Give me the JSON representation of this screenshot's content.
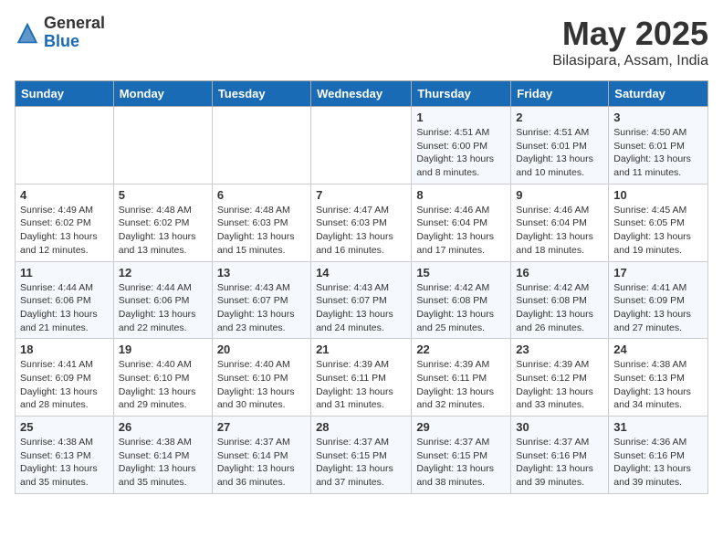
{
  "header": {
    "logo_general": "General",
    "logo_blue": "Blue",
    "month_title": "May 2025",
    "subtitle": "Bilasipara, Assam, India"
  },
  "weekdays": [
    "Sunday",
    "Monday",
    "Tuesday",
    "Wednesday",
    "Thursday",
    "Friday",
    "Saturday"
  ],
  "weeks": [
    [
      {
        "day": "",
        "info": ""
      },
      {
        "day": "",
        "info": ""
      },
      {
        "day": "",
        "info": ""
      },
      {
        "day": "",
        "info": ""
      },
      {
        "day": "1",
        "info": "Sunrise: 4:51 AM\nSunset: 6:00 PM\nDaylight: 13 hours and 8 minutes."
      },
      {
        "day": "2",
        "info": "Sunrise: 4:51 AM\nSunset: 6:01 PM\nDaylight: 13 hours and 10 minutes."
      },
      {
        "day": "3",
        "info": "Sunrise: 4:50 AM\nSunset: 6:01 PM\nDaylight: 13 hours and 11 minutes."
      }
    ],
    [
      {
        "day": "4",
        "info": "Sunrise: 4:49 AM\nSunset: 6:02 PM\nDaylight: 13 hours and 12 minutes."
      },
      {
        "day": "5",
        "info": "Sunrise: 4:48 AM\nSunset: 6:02 PM\nDaylight: 13 hours and 13 minutes."
      },
      {
        "day": "6",
        "info": "Sunrise: 4:48 AM\nSunset: 6:03 PM\nDaylight: 13 hours and 15 minutes."
      },
      {
        "day": "7",
        "info": "Sunrise: 4:47 AM\nSunset: 6:03 PM\nDaylight: 13 hours and 16 minutes."
      },
      {
        "day": "8",
        "info": "Sunrise: 4:46 AM\nSunset: 6:04 PM\nDaylight: 13 hours and 17 minutes."
      },
      {
        "day": "9",
        "info": "Sunrise: 4:46 AM\nSunset: 6:04 PM\nDaylight: 13 hours and 18 minutes."
      },
      {
        "day": "10",
        "info": "Sunrise: 4:45 AM\nSunset: 6:05 PM\nDaylight: 13 hours and 19 minutes."
      }
    ],
    [
      {
        "day": "11",
        "info": "Sunrise: 4:44 AM\nSunset: 6:06 PM\nDaylight: 13 hours and 21 minutes."
      },
      {
        "day": "12",
        "info": "Sunrise: 4:44 AM\nSunset: 6:06 PM\nDaylight: 13 hours and 22 minutes."
      },
      {
        "day": "13",
        "info": "Sunrise: 4:43 AM\nSunset: 6:07 PM\nDaylight: 13 hours and 23 minutes."
      },
      {
        "day": "14",
        "info": "Sunrise: 4:43 AM\nSunset: 6:07 PM\nDaylight: 13 hours and 24 minutes."
      },
      {
        "day": "15",
        "info": "Sunrise: 4:42 AM\nSunset: 6:08 PM\nDaylight: 13 hours and 25 minutes."
      },
      {
        "day": "16",
        "info": "Sunrise: 4:42 AM\nSunset: 6:08 PM\nDaylight: 13 hours and 26 minutes."
      },
      {
        "day": "17",
        "info": "Sunrise: 4:41 AM\nSunset: 6:09 PM\nDaylight: 13 hours and 27 minutes."
      }
    ],
    [
      {
        "day": "18",
        "info": "Sunrise: 4:41 AM\nSunset: 6:09 PM\nDaylight: 13 hours and 28 minutes."
      },
      {
        "day": "19",
        "info": "Sunrise: 4:40 AM\nSunset: 6:10 PM\nDaylight: 13 hours and 29 minutes."
      },
      {
        "day": "20",
        "info": "Sunrise: 4:40 AM\nSunset: 6:10 PM\nDaylight: 13 hours and 30 minutes."
      },
      {
        "day": "21",
        "info": "Sunrise: 4:39 AM\nSunset: 6:11 PM\nDaylight: 13 hours and 31 minutes."
      },
      {
        "day": "22",
        "info": "Sunrise: 4:39 AM\nSunset: 6:11 PM\nDaylight: 13 hours and 32 minutes."
      },
      {
        "day": "23",
        "info": "Sunrise: 4:39 AM\nSunset: 6:12 PM\nDaylight: 13 hours and 33 minutes."
      },
      {
        "day": "24",
        "info": "Sunrise: 4:38 AM\nSunset: 6:13 PM\nDaylight: 13 hours and 34 minutes."
      }
    ],
    [
      {
        "day": "25",
        "info": "Sunrise: 4:38 AM\nSunset: 6:13 PM\nDaylight: 13 hours and 35 minutes."
      },
      {
        "day": "26",
        "info": "Sunrise: 4:38 AM\nSunset: 6:14 PM\nDaylight: 13 hours and 35 minutes."
      },
      {
        "day": "27",
        "info": "Sunrise: 4:37 AM\nSunset: 6:14 PM\nDaylight: 13 hours and 36 minutes."
      },
      {
        "day": "28",
        "info": "Sunrise: 4:37 AM\nSunset: 6:15 PM\nDaylight: 13 hours and 37 minutes."
      },
      {
        "day": "29",
        "info": "Sunrise: 4:37 AM\nSunset: 6:15 PM\nDaylight: 13 hours and 38 minutes."
      },
      {
        "day": "30",
        "info": "Sunrise: 4:37 AM\nSunset: 6:16 PM\nDaylight: 13 hours and 39 minutes."
      },
      {
        "day": "31",
        "info": "Sunrise: 4:36 AM\nSunset: 6:16 PM\nDaylight: 13 hours and 39 minutes."
      }
    ]
  ]
}
